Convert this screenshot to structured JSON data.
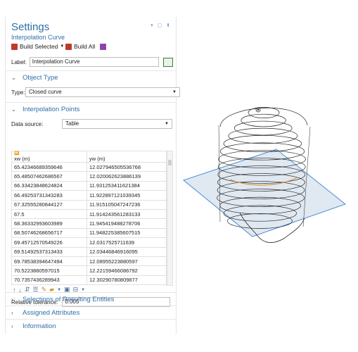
{
  "settings": {
    "title": "Settings",
    "subtitle": "Interpolation Curve",
    "window_controls": "▾ ▢ ⬍",
    "toolbar": {
      "build_selected": "Build Selected",
      "build_all": "Build All"
    },
    "label_caption": "Label:",
    "label_value": "Interpolation Curve"
  },
  "object_type": {
    "header": "Object Type",
    "type_caption": "Type:",
    "type_value": "Closed curve"
  },
  "interp": {
    "header": "Interpolation Points",
    "source_caption": "Data source:",
    "source_value": "Table",
    "columns": [
      "xw (m)",
      "yw (m)"
    ],
    "rows": [
      [
        "65.42346689359646",
        "12.027946505536768"
      ],
      [
        "65.48507462686567",
        "12.020062623886139"
      ],
      [
        "66.33423848624824",
        "11.931253411621384"
      ],
      [
        "66.49253731343283",
        "11.922897121039345"
      ],
      [
        "67.32555280844127",
        "11.915105047247236"
      ],
      [
        "67.5",
        "11.914243561283133"
      ],
      [
        "68.36332993603989",
        "11.945419488278706"
      ],
      [
        "68.50746268656717",
        "11.948225385607515"
      ],
      [
        "69.45712570549226",
        "12.0317525711639"
      ],
      [
        "69.51492537313433",
        "12.03446846916095"
      ],
      [
        "69.78538394647494",
        "12.08955223880597"
      ],
      [
        "70.5223880597015",
        "12.22159466086792"
      ],
      [
        "70.7357436289943",
        "12.30290780809877"
      ]
    ]
  },
  "tolerance": {
    "caption": "Relative tolerance:",
    "value": "0.005"
  },
  "sections": [
    "Selections of Resulting Entities",
    "Assigned Attributes",
    "Information"
  ],
  "colors": {
    "accent": "#2f6fa8",
    "plane": "#4a90d9"
  }
}
